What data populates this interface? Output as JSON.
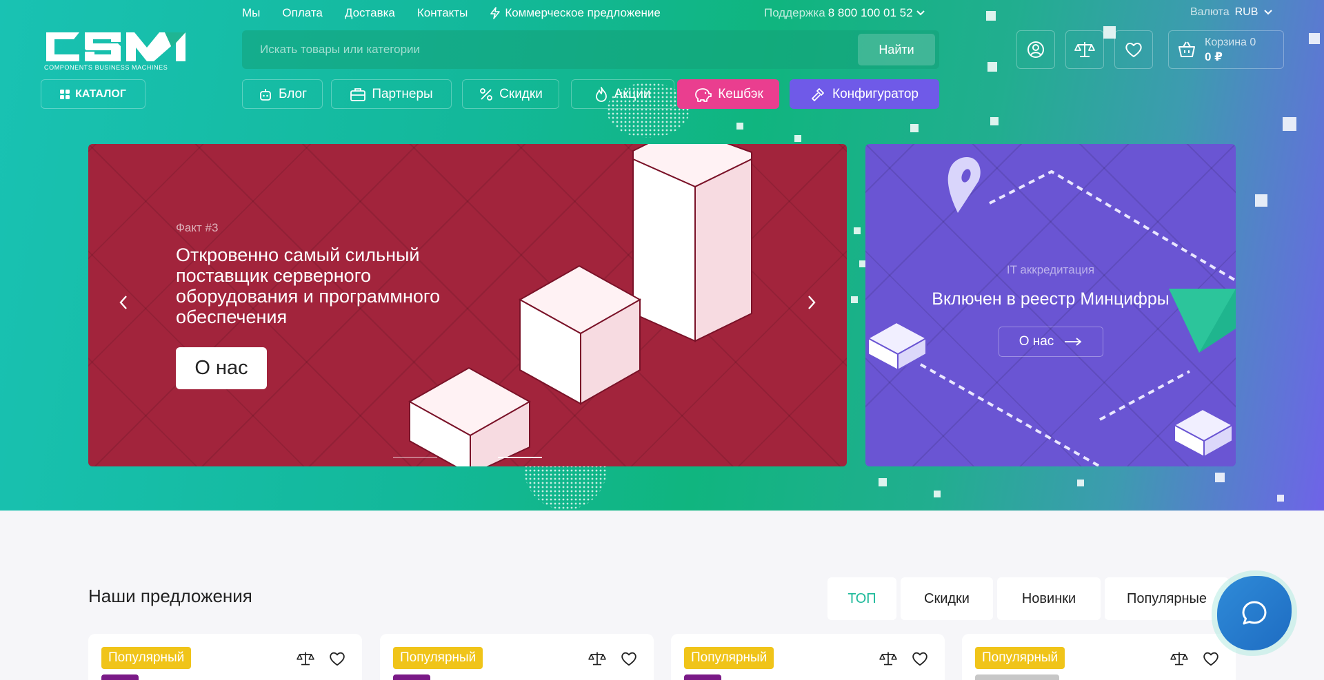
{
  "header": {
    "nav": [
      {
        "label": "Мы"
      },
      {
        "label": "Оплата"
      },
      {
        "label": "Доставка"
      },
      {
        "label": "Контакты"
      },
      {
        "label": "Коммерческое предложение"
      }
    ],
    "support_label": "Поддержка",
    "support_phone": "8 800 100 01 52",
    "currency_label": "Валюта",
    "currency_value": "RUB",
    "logo_text": "CBM",
    "logo_subtitle": "COMPONENTS BUSINESS MACHINES",
    "search_placeholder": "Искать товары или категории",
    "search_button": "Найти",
    "cart_label": "Корзина 0",
    "cart_total": "0 ₽",
    "catalog_label": "КАТАЛОГ"
  },
  "subnav": [
    {
      "label": "Блог"
    },
    {
      "label": "Партнеры"
    },
    {
      "label": "Скидки"
    },
    {
      "label": "Акции"
    },
    {
      "label": "Кешбэк"
    },
    {
      "label": "Конфигуратор"
    }
  ],
  "hero": {
    "main": {
      "kicker": "Факт #3",
      "title": "Откровенно самый сильный поставщик серверного оборудования и программного обеспечения",
      "cta": "О нас"
    },
    "side": {
      "kicker": "IT аккредитация",
      "title": "Включен в реестр Минцифры",
      "cta": "О нас"
    }
  },
  "offers": {
    "title": "Наши предложения",
    "tabs": [
      {
        "label": "ТОП"
      },
      {
        "label": "Скидки"
      },
      {
        "label": "Новинки"
      },
      {
        "label": "Популярные"
      }
    ],
    "cards": [
      {
        "badge": "Популярный"
      },
      {
        "badge": "Популярный"
      },
      {
        "badge": "Популярный"
      },
      {
        "badge": "Популярный"
      }
    ]
  },
  "colors": {
    "accent": "#1bb999",
    "cashback": "#ea3e8f",
    "configurator": "#6f5ae8",
    "slide_main": "#a2243c",
    "slide_side": "#6a55d3",
    "badge": "#f0c419"
  }
}
